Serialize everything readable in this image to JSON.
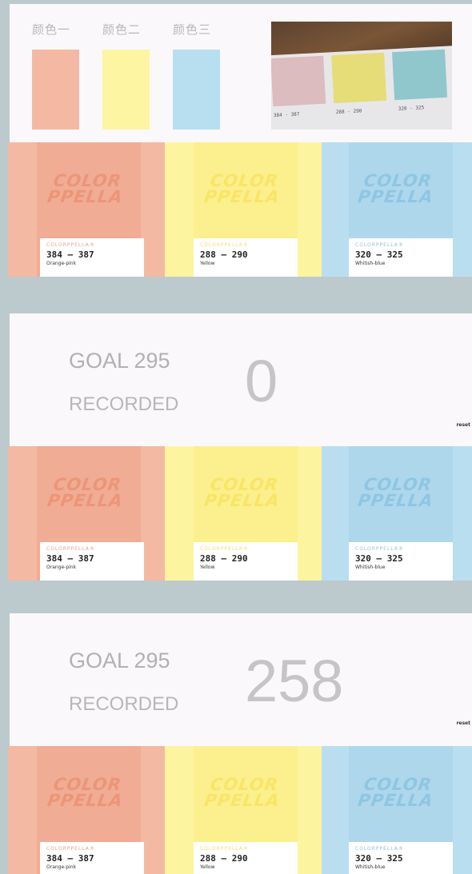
{
  "header": {
    "swatch_labels": [
      "颜色一",
      "颜色二",
      "颜色三"
    ]
  },
  "photo": {
    "codes": [
      "384 - 387",
      "288 - 290",
      "320 - 325"
    ]
  },
  "colors": [
    {
      "brand": "COLORPPELLA®",
      "code": "384 — 387",
      "name": "Orange-pink",
      "logo_line1": "COLOR",
      "logo_line2": "PPELLA",
      "base": "#f4b9a3",
      "shade": "#f0ac94",
      "logo_color": "#ec9577",
      "brand_color": "#ef9f86"
    },
    {
      "brand": "COLORPPELLA®",
      "code": "288 — 290",
      "name": "Yellow",
      "logo_line1": "COLOR",
      "logo_line2": "PPELLA",
      "base": "#fdf4a0",
      "shade": "#fcef8e",
      "logo_color": "#f9e565",
      "brand_color": "#f6dc6a"
    },
    {
      "brand": "COLORPPELLA®",
      "code": "320 — 325",
      "name": "Whitish-blue",
      "logo_line1": "COLOR",
      "logo_line2": "PPELLA",
      "base": "#b9def0",
      "shade": "#aed7ec",
      "logo_color": "#8ec6e3",
      "brand_color": "#8fbfd8"
    }
  ],
  "goal_panels": [
    {
      "goal_label": "GOAL 295",
      "recorded_label": "RECORDED",
      "count": "0",
      "reset_label": "reset"
    },
    {
      "goal_label": "GOAL 295",
      "recorded_label": "RECORDED",
      "count": "258",
      "reset_label": "reset"
    }
  ]
}
